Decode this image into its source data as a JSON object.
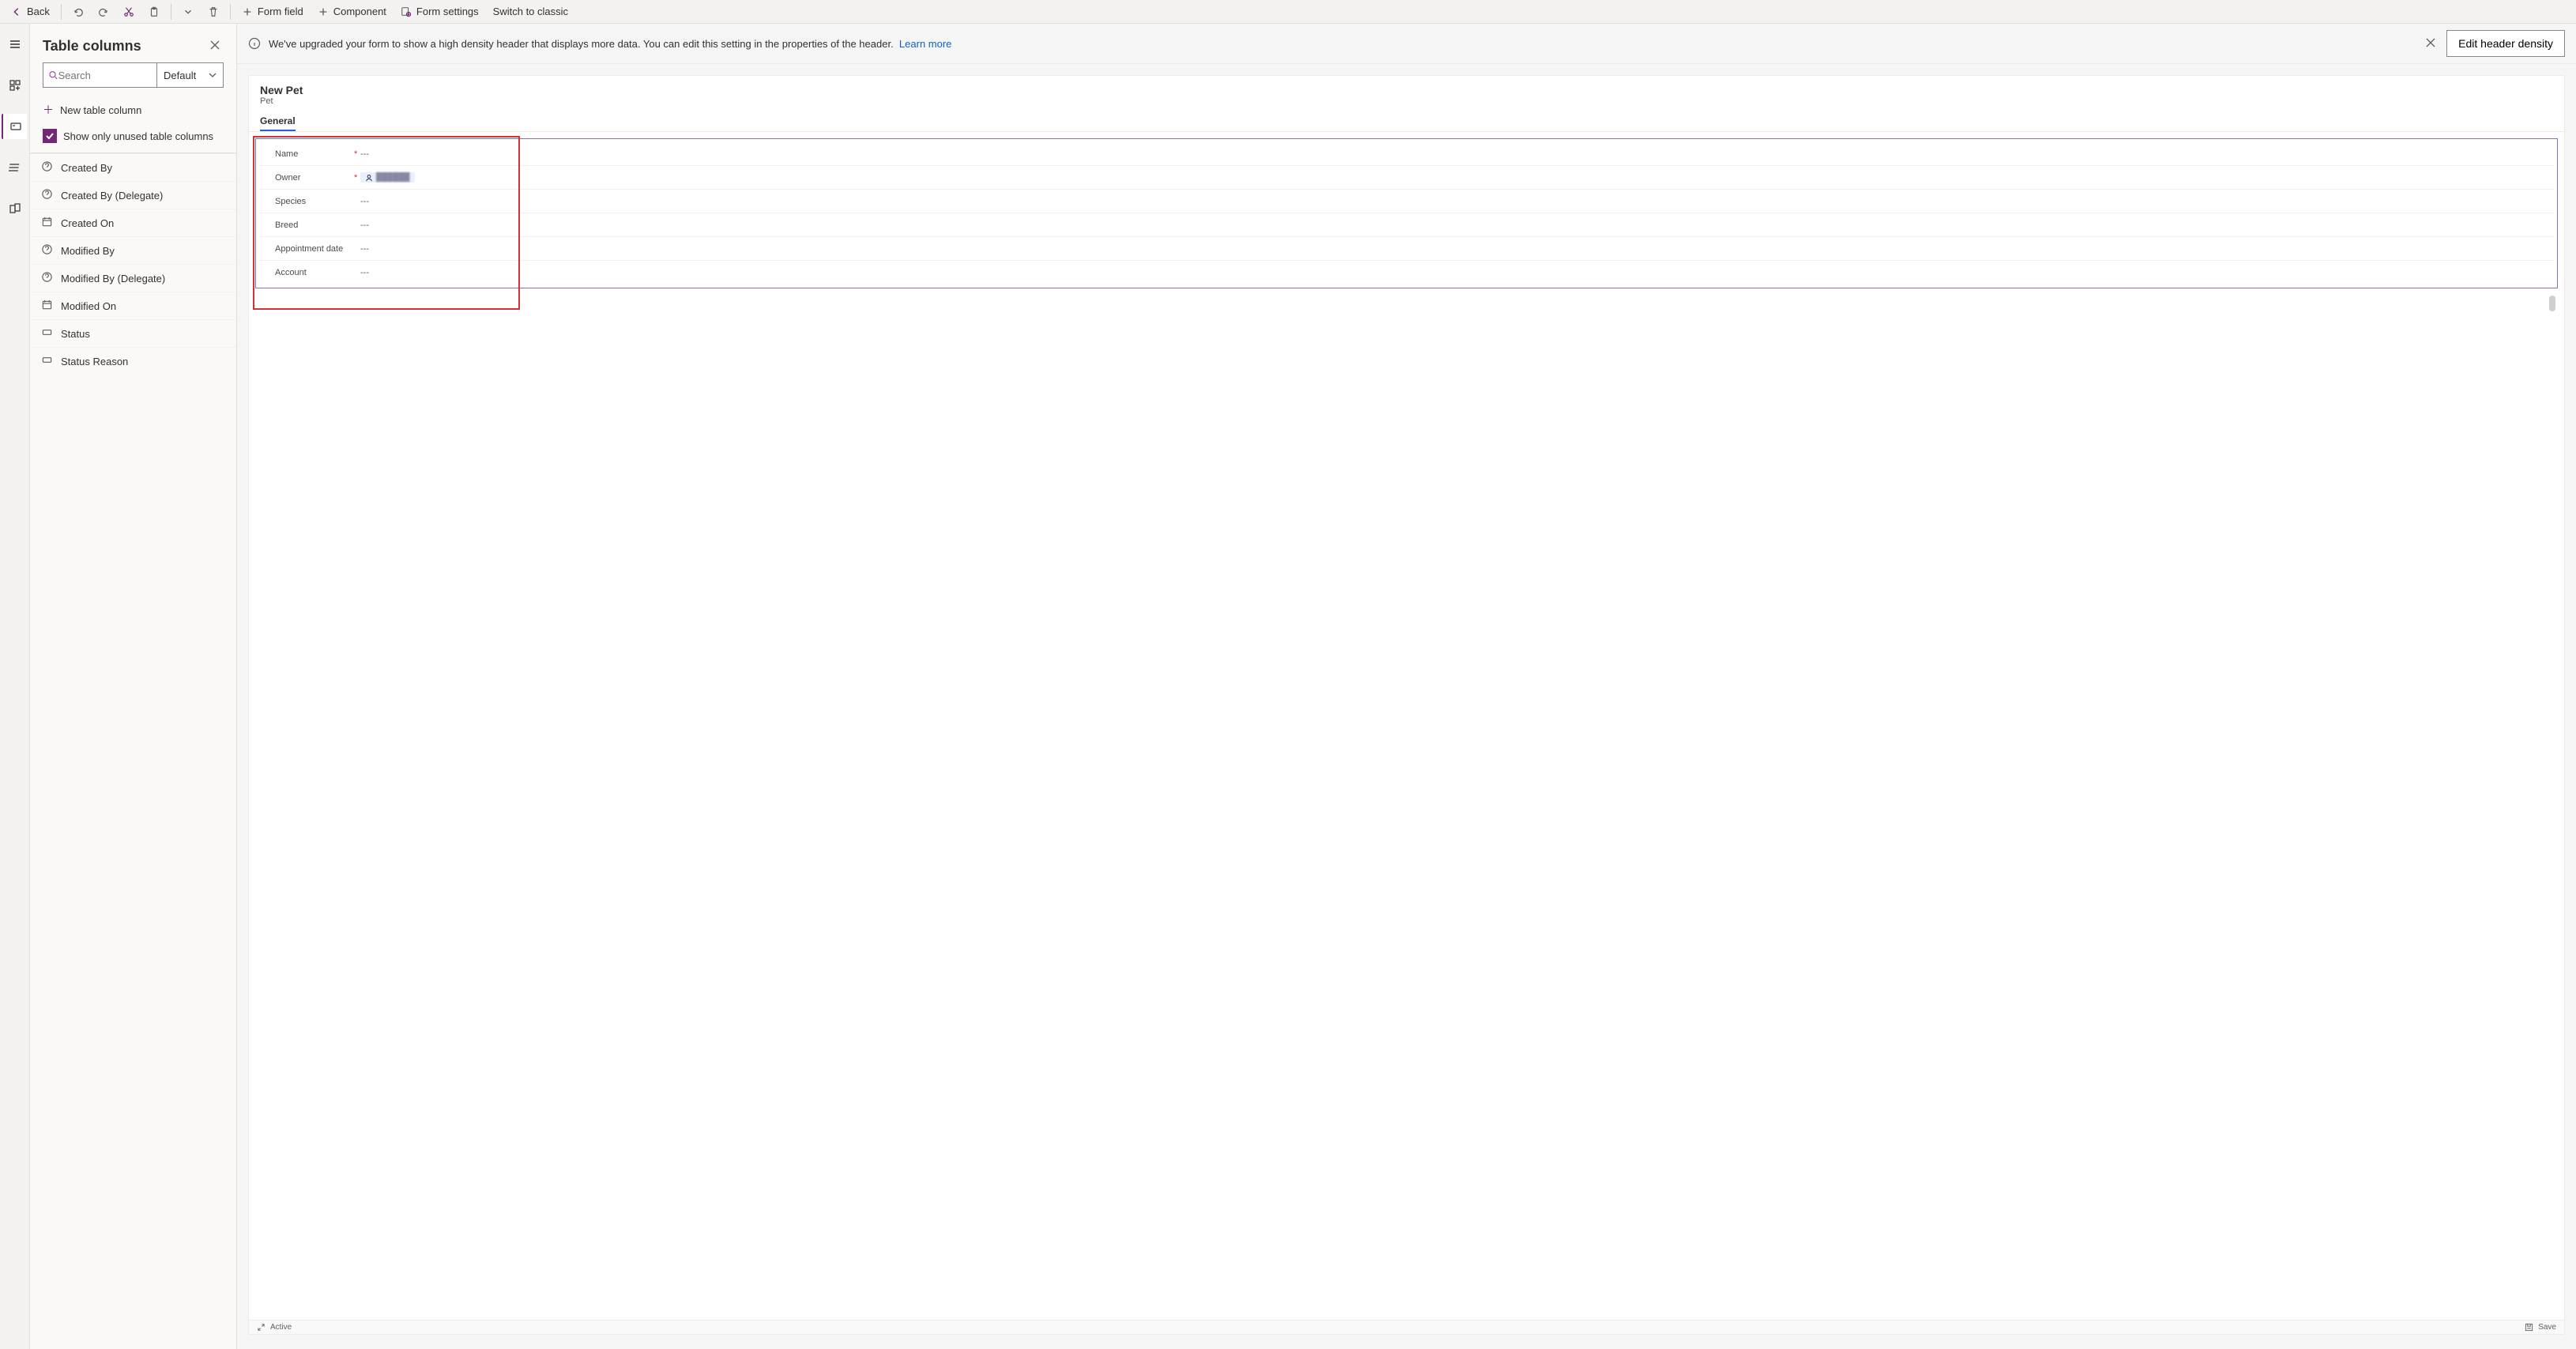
{
  "toolbar": {
    "back": "Back",
    "form_field": "Form field",
    "component": "Component",
    "form_settings": "Form settings",
    "switch_classic": "Switch to classic"
  },
  "left_rail": {
    "selected_index": 2
  },
  "side_panel": {
    "title": "Table columns",
    "search_placeholder": "Search",
    "filter_label": "Default",
    "new_column": "New table column",
    "show_unused": "Show only unused table columns",
    "columns": [
      {
        "label": "Created By",
        "icon": "help"
      },
      {
        "label": "Created By (Delegate)",
        "icon": "help"
      },
      {
        "label": "Created On",
        "icon": "calendar"
      },
      {
        "label": "Modified By",
        "icon": "help"
      },
      {
        "label": "Modified By (Delegate)",
        "icon": "help"
      },
      {
        "label": "Modified On",
        "icon": "calendar"
      },
      {
        "label": "Status",
        "icon": "rect"
      },
      {
        "label": "Status Reason",
        "icon": "rect"
      }
    ]
  },
  "notice": {
    "text": "We've upgraded your form to show a high density header that displays more data. You can edit this setting in the properties of the header.",
    "learn_more": "Learn more",
    "button": "Edit header density"
  },
  "form": {
    "title": "New Pet",
    "subtitle": "Pet",
    "tab": "General",
    "fields": [
      {
        "label": "Name",
        "required": true,
        "value": "---",
        "type": "text"
      },
      {
        "label": "Owner",
        "required": true,
        "value": "",
        "type": "owner"
      },
      {
        "label": "Species",
        "required": false,
        "value": "---",
        "type": "text"
      },
      {
        "label": "Breed",
        "required": false,
        "value": "---",
        "type": "text"
      },
      {
        "label": "Appointment date",
        "required": false,
        "value": "---",
        "type": "text"
      },
      {
        "label": "Account",
        "required": false,
        "value": "---",
        "type": "text"
      }
    ]
  },
  "statusbar": {
    "state": "Active",
    "save": "Save"
  }
}
